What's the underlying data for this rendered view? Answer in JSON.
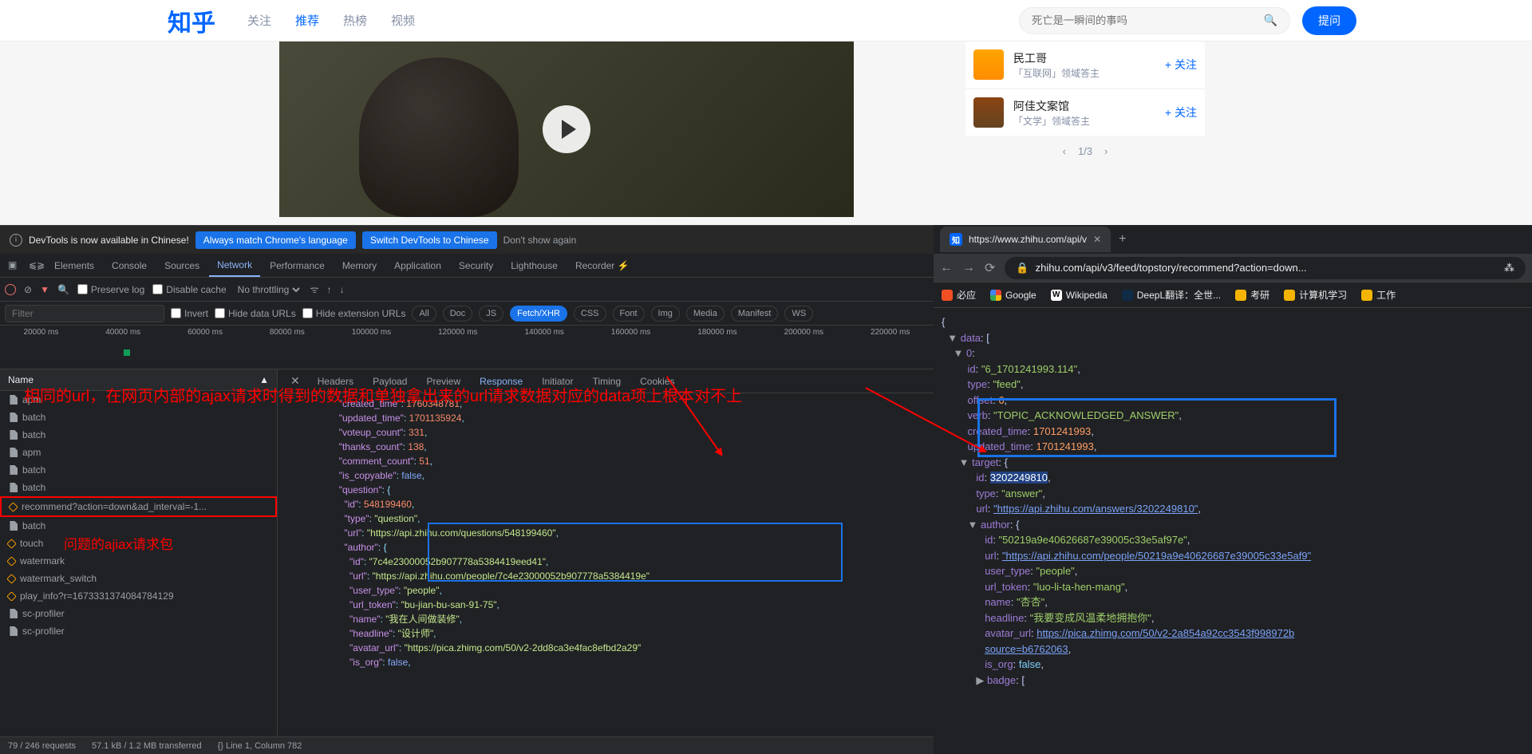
{
  "zhihu": {
    "logo": "知乎",
    "nav": [
      "关注",
      "推荐",
      "热榜",
      "视频"
    ],
    "nav_active": 1,
    "search_placeholder": "死亡是一瞬间的事吗",
    "ask_btn": "提问",
    "users": [
      {
        "name": "民工哥",
        "desc": "「互联网」领域答主",
        "follow": "+ 关注"
      },
      {
        "name": "阿佳文案馆",
        "desc": "「文学」领域答主",
        "follow": "+ 关注"
      }
    ],
    "pager": {
      "prev": "‹",
      "text": "1/3",
      "next": "›"
    }
  },
  "banner": {
    "text": "DevTools is now available in Chinese!",
    "btn1": "Always match Chrome's language",
    "btn2": "Switch DevTools to Chinese",
    "dismiss": "Don't show again"
  },
  "devtools": {
    "tabs": [
      "Elements",
      "Console",
      "Sources",
      "Network",
      "Performance",
      "Memory",
      "Application",
      "Security",
      "Lighthouse",
      "Recorder ⚡"
    ],
    "tabs_active": 3,
    "toolbar": {
      "preserve": "Preserve log",
      "disable": "Disable cache",
      "throttle": "No throttling"
    },
    "filter": {
      "placeholder": "Filter",
      "invert": "Invert",
      "hide_data": "Hide data URLs",
      "hide_ext": "Hide extension URLs"
    },
    "pills": [
      "All",
      "Doc",
      "JS",
      "Fetch/XHR",
      "CSS",
      "Font",
      "Img",
      "Media",
      "Manifest",
      "WS"
    ],
    "pills_active": 3,
    "timeline": [
      "20000 ms",
      "40000 ms",
      "60000 ms",
      "80000 ms",
      "100000 ms",
      "120000 ms",
      "140000 ms",
      "160000 ms",
      "180000 ms",
      "200000 ms",
      "220000 ms"
    ],
    "sidebar_header": "Name",
    "requests": [
      {
        "icon": "doc",
        "name": "apm"
      },
      {
        "icon": "doc",
        "name": "batch"
      },
      {
        "icon": "doc",
        "name": "batch"
      },
      {
        "icon": "doc",
        "name": "apm"
      },
      {
        "icon": "doc",
        "name": "batch"
      },
      {
        "icon": "doc",
        "name": "batch"
      },
      {
        "icon": "xhr",
        "name": "recommend?action=down&ad_interval=-1...",
        "hl": true
      },
      {
        "icon": "doc",
        "name": "batch"
      },
      {
        "icon": "xhr",
        "name": "touch"
      },
      {
        "icon": "xhr",
        "name": "watermark"
      },
      {
        "icon": "xhr",
        "name": "watermark_switch"
      },
      {
        "icon": "xhr",
        "name": "play_info?r=1673331374084784129"
      },
      {
        "icon": "doc",
        "name": "sc-profiler"
      },
      {
        "icon": "doc",
        "name": "sc-profiler"
      }
    ],
    "content_tabs": [
      "Headers",
      "Payload",
      "Preview",
      "Response",
      "Initiator",
      "Timing",
      "Cookies"
    ],
    "content_active": 3,
    "status": {
      "requests": "79 / 246 requests",
      "transfer": "57.1 kB / 1.2 MB transferred",
      "cursor": "{} Line 1, Column 782"
    }
  },
  "json_left": {
    "l1": {
      "k": "created_time",
      "v": "1760348781"
    },
    "l2": {
      "k": "updated_time",
      "v": "1701135924"
    },
    "l3": {
      "k": "voteup_count",
      "v": "331"
    },
    "l4": {
      "k": "thanks_count",
      "v": "138"
    },
    "l5": {
      "k": "comment_count",
      "v": "51"
    },
    "l6": {
      "k": "is_copyable",
      "v": "false"
    },
    "l7": {
      "k": "question"
    },
    "l8": {
      "k": "id",
      "v": "548199460"
    },
    "l9": {
      "k": "type",
      "v": "question"
    },
    "l10": {
      "k": "url",
      "v": "https://api.zhihu.com/questions/548199460"
    },
    "l11": {
      "k": "author"
    },
    "l12": {
      "k": "id",
      "v": "7c4e23000052b907778a5384419eed41"
    },
    "l13": {
      "k": "url",
      "v": "https://api.zhihu.com/people/7c4e23000052b907778a5384419e"
    },
    "l14": {
      "k": "user_type",
      "v": "people"
    },
    "l15": {
      "k": "url_token",
      "v": "bu-jian-bu-san-91-75"
    },
    "l16": {
      "k": "name",
      "v": "我在人间做装修"
    },
    "l17": {
      "k": "headline",
      "v": "设计师"
    },
    "l18": {
      "k": "avatar_url",
      "v": "https://pica.zhimg.com/50/v2-2dd8ca3e4fac8efbd2a29"
    },
    "l19": {
      "k": "is_org",
      "v": "false"
    }
  },
  "chrome": {
    "tab_title": "https://www.zhihu.com/api/v",
    "url": "zhihu.com/api/v3/feed/topstory/recommend?action=down...",
    "bookmarks": [
      {
        "icon": "bing",
        "label": "必应"
      },
      {
        "icon": "google",
        "label": "Google"
      },
      {
        "icon": "wiki",
        "label": "Wikipedia"
      },
      {
        "icon": "deepl",
        "label": "DeepL翻译：全世..."
      },
      {
        "icon": "folder",
        "label": "考研"
      },
      {
        "icon": "folder",
        "label": "计算机学习"
      },
      {
        "icon": "folder",
        "label": "工作"
      }
    ]
  },
  "json_right": {
    "l0": {
      "k": "data"
    },
    "l1": {
      "k": "0"
    },
    "l2": {
      "k": "id",
      "v": "6_1701241993.114"
    },
    "l3": {
      "k": "type",
      "v": "feed"
    },
    "l4": {
      "k": "offset",
      "v": "6"
    },
    "l5": {
      "k": "verb",
      "v": "TOPIC_ACKNOWLEDGED_ANSWER"
    },
    "l6": {
      "k": "created_time",
      "v": "1701241993"
    },
    "l7": {
      "k": "updated_time",
      "v": "1701241993"
    },
    "l8": {
      "k": "target"
    },
    "l9": {
      "k": "id",
      "v": "3202249810"
    },
    "l10": {
      "k": "type",
      "v": "answer"
    },
    "l11": {
      "k": "url",
      "v": "https://api.zhihu.com/answers/3202249810"
    },
    "l12": {
      "k": "author"
    },
    "l13": {
      "k": "id",
      "v": "50219a9e40626687e39005c33e5af97e"
    },
    "l14": {
      "k": "url",
      "v": "https://api.zhihu.com/people/50219a9e40626687e39005c33e5af9"
    },
    "l15": {
      "k": "user_type",
      "v": "people"
    },
    "l16": {
      "k": "url_token",
      "v": "luo-li-ta-hen-mang"
    },
    "l17": {
      "k": "name",
      "v": "杏杏"
    },
    "l18": {
      "k": "headline",
      "v": "我要变成风温柔地拥抱你"
    },
    "l19": {
      "k": "avatar_url",
      "v": "https://pica.zhimg.com/50/v2-2a854a92cc3543f998972b"
    },
    "l19b": {
      "v": "source=b6762063"
    },
    "l20": {
      "k": "is_org",
      "v": "false"
    },
    "l21": {
      "k": "badge"
    }
  },
  "annotations": {
    "red1": "相同的url，在网页内部的ajax请求时得到的数据和单独拿出来的url请求数据对应的data项上根本对不上",
    "red2": "问题的ajiax请求包"
  }
}
